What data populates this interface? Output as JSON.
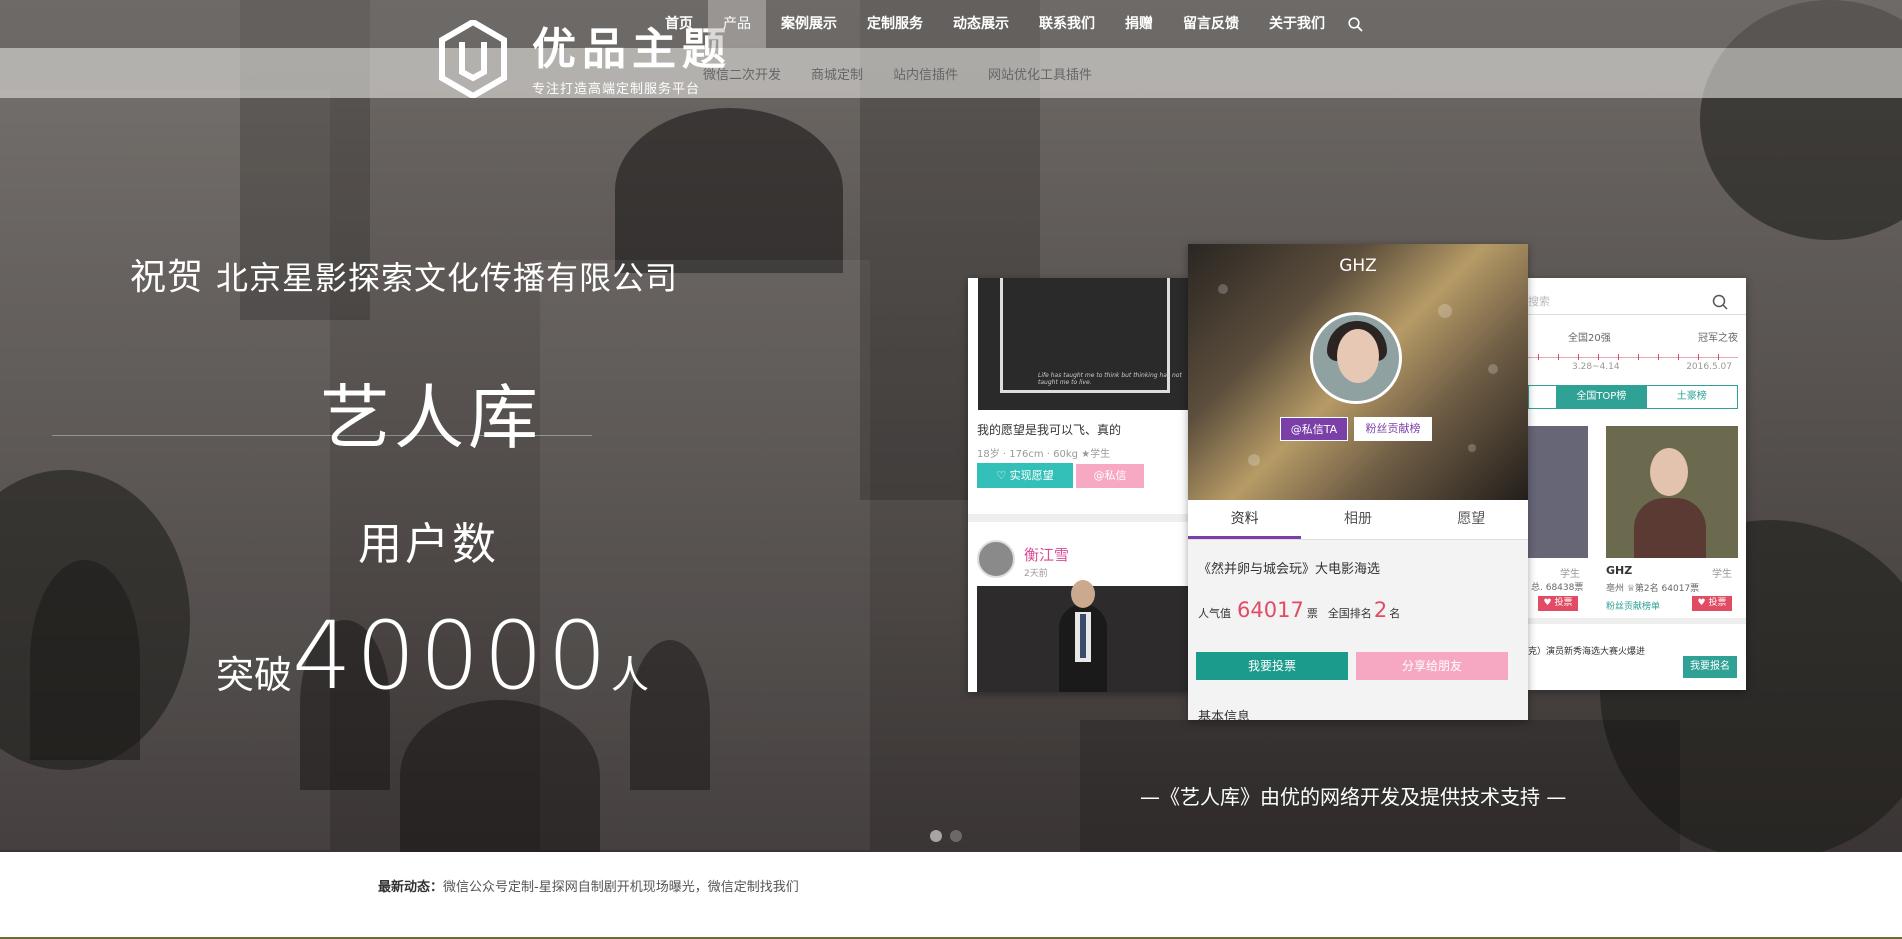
{
  "header": {
    "logo_title": "优品主题",
    "logo_subtitle": "专注打造高端定制服务平台",
    "nav": [
      {
        "label": "首页"
      },
      {
        "label": "产品"
      },
      {
        "label": "案例展示"
      },
      {
        "label": "定制服务"
      },
      {
        "label": "动态展示"
      },
      {
        "label": "联系我们"
      },
      {
        "label": "捐赠"
      },
      {
        "label": "留言反馈"
      },
      {
        "label": "关于我们"
      }
    ],
    "active_index": 1,
    "subnav": [
      {
        "label": "微信二次开发"
      },
      {
        "label": "商城定制"
      },
      {
        "label": "站内信插件"
      },
      {
        "label": "网站优化工具插件"
      }
    ]
  },
  "hero": {
    "congrats_prefix": "祝贺",
    "company": "北京星影探索文化传播有限公司",
    "artist_db": "艺人库",
    "user_count_label": "用户数",
    "break_prefix": "突破",
    "break_number": "40000",
    "break_suffix": "人",
    "support_text": "—《艺人库》由优的网络开发及提供技术支持 —"
  },
  "phone_left": {
    "quote": "Life has taught me to think but thinking has not taught me to live.",
    "wish": "我的愿望是我可以飞、真的",
    "meta": "18岁 · 176cm · 60kg  ★学生",
    "btn_wish": "♡ 实现愿望",
    "btn_msg": "@私信",
    "user_name": "衡江雪",
    "user_time": "2天前"
  },
  "phone_mid": {
    "title": "GHZ",
    "btn_msg": "@私信TA",
    "btn_fans": "粉丝贡献榜",
    "tabs": [
      "资料",
      "相册",
      "愿望"
    ],
    "movie": "《然并卵与城会玩》大电影海选",
    "pop_label": "人气值",
    "pop_value": "64017",
    "pop_unit": "票",
    "rank_label": "全国排名",
    "rank_value": "2",
    "rank_unit": "名",
    "btn_vote": "我要投票",
    "btn_share": "分享给朋友",
    "basic_info": "基本信息"
  },
  "phone_right": {
    "search_placeholder": "搜索",
    "timeline_1": "全国20强",
    "timeline_2": "冠军之夜",
    "date_1": "3.28~4.14",
    "date_2": "2016.5.07",
    "tab_1": "全国TOP榜",
    "tab_2": "土豪榜",
    "left_role": "学生",
    "left_info": "总. 68438票",
    "left_vote": "♥ 投票",
    "name": "GHZ",
    "role": "学生",
    "info": "亳州  ♕第2名 64017票",
    "fans": "粉丝贡献榜单",
    "vote": "♥ 投票",
    "bottom": "克）演员新秀海选大赛火爆进",
    "signup": "我要报名"
  },
  "news": {
    "label": "最新动态：",
    "text": "微信公众号定制-星探网自制剧开机现场曝光，微信定制找我们"
  },
  "colors": {
    "teal": "#1a9b8c",
    "pink": "#f6a8c3",
    "purple": "#7b3fa8",
    "red": "#e14b63"
  }
}
